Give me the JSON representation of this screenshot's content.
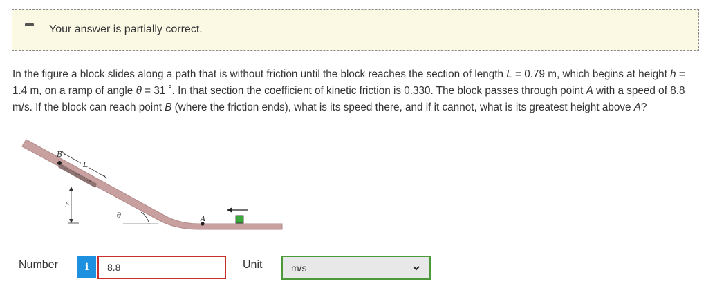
{
  "feedback": {
    "status_text": "Your answer is partially correct.",
    "status_color": "#555555",
    "box_color": "#fbf8e3"
  },
  "problem": {
    "p1": "In the figure a block slides along a path that is without friction until the block reaches the section of length ",
    "var_L": "L",
    "p2": " = 0.79 m, which begins at height ",
    "var_h": "h",
    "p3": " = 1.4 m, on a ramp of angle ",
    "var_theta": "θ",
    "p4": " = 31 ˚. In that section the coefficient of kinetic friction is 0.330. The block passes through point ",
    "var_A1": "A",
    "p5": " with a speed of 8.8 m/s. If the block can reach point ",
    "var_B": "B",
    "p6": " (where the friction ends), what is its speed there, and if it cannot, what is its greatest height above ",
    "var_A2": "A",
    "p7": "?"
  },
  "figure": {
    "label_B": "B",
    "label_L": "L",
    "label_h": "h",
    "label_theta": "θ",
    "label_A": "A",
    "track_color": "#c9a0a0",
    "block_color": "#3aa83a"
  },
  "answer": {
    "number_label": "Number",
    "info_icon_text": "i",
    "number_value": "8.8",
    "unit_label": "Unit",
    "unit_value": "m/s",
    "error_color": "#c9302c",
    "ok_color": "#4a9a3a"
  }
}
